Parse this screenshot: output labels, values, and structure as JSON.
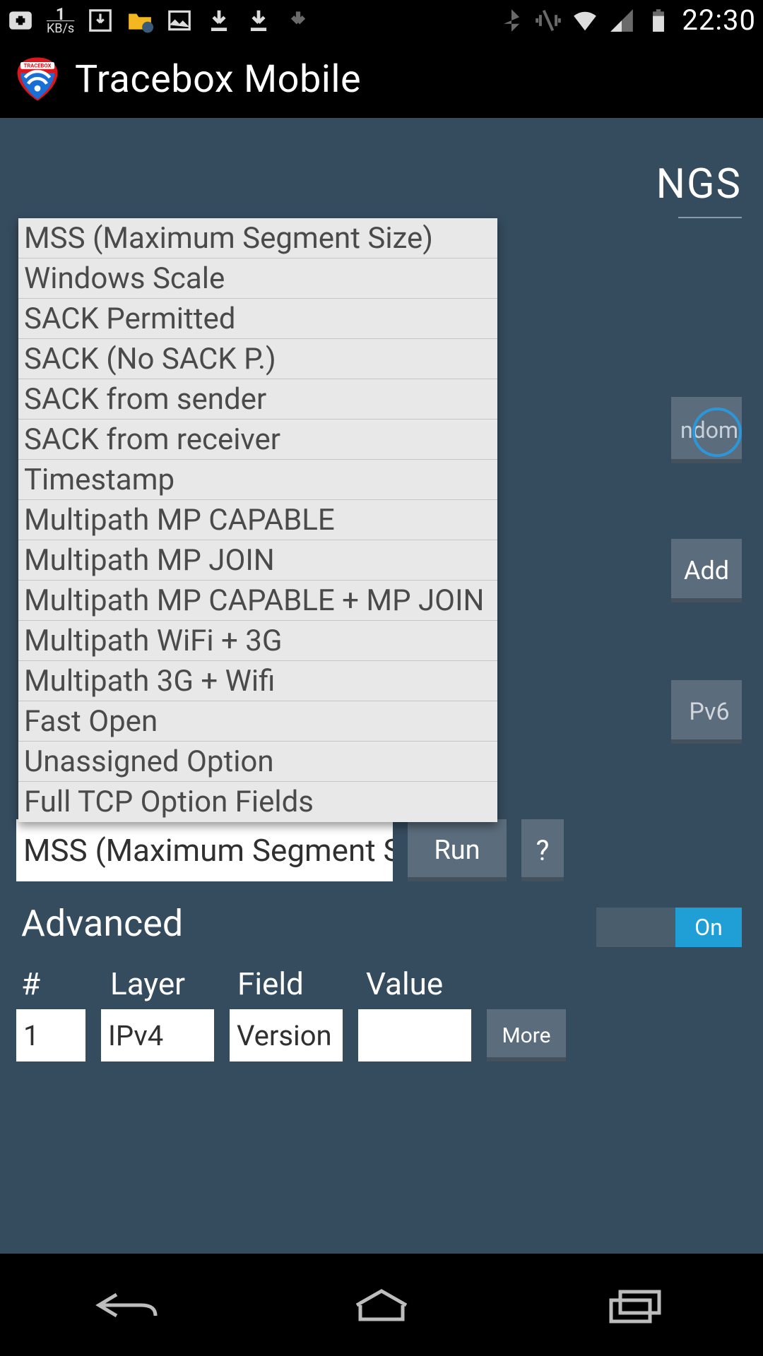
{
  "status": {
    "time": "22:30",
    "kbs_value": "1",
    "kbs_unit": "KB/s"
  },
  "app": {
    "title": "Tracebox Mobile"
  },
  "bg": {
    "heading_fragment": "NGS",
    "random_fragment": "ndom",
    "add_label": "Add",
    "ipv6_fragment": "Pv6",
    "selected_option": "MSS (Maximum Segment Siz",
    "run_label": "Run",
    "help_label": "?",
    "advanced_label": "Advanced",
    "toggle_state": "On",
    "more_label": "More"
  },
  "columns": {
    "num": "#",
    "layer": "Layer",
    "field": "Field",
    "value": "Value"
  },
  "row": {
    "num": "1",
    "layer": "IPv4",
    "field": "Version",
    "value": ""
  },
  "options": [
    "MSS (Maximum Segment Size)",
    "Windows Scale",
    "SACK Permitted",
    "SACK (No SACK P.)",
    "SACK from sender",
    "SACK from receiver",
    "Timestamp",
    "Multipath MP CAPABLE",
    "Multipath MP JOIN",
    "Multipath MP CAPABLE + MP JOIN",
    "Multipath WiFi + 3G",
    "Multipath 3G + Wifi",
    "Fast Open",
    "Unassigned Option",
    "Full TCP Option Fields"
  ]
}
